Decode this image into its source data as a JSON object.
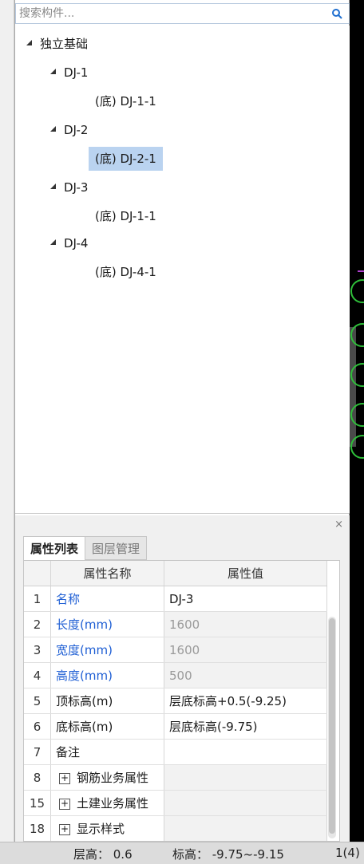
{
  "search": {
    "placeholder": "搜索构件...",
    "value": ""
  },
  "tree": {
    "root": "独立基础",
    "groups": [
      {
        "label": "DJ-1",
        "child": "(底) DJ-1-1"
      },
      {
        "label": "DJ-2",
        "child": "(底) DJ-2-1"
      },
      {
        "label": "DJ-3",
        "child": "(底) DJ-1-1"
      },
      {
        "label": "DJ-4",
        "child": "(底) DJ-4-1"
      }
    ]
  },
  "props": {
    "close": "×",
    "tabs": [
      "属性列表",
      "图层管理"
    ],
    "headers": [
      "属性名称",
      "属性值"
    ],
    "rows": [
      {
        "num": "1",
        "name": "名称",
        "value": "DJ-3"
      },
      {
        "num": "2",
        "name": "长度(mm)",
        "value": "1600"
      },
      {
        "num": "3",
        "name": "宽度(mm)",
        "value": "1600"
      },
      {
        "num": "4",
        "name": "高度(mm)",
        "value": "500"
      },
      {
        "num": "5",
        "name": "顶标高(m)",
        "value": "层底标高+0.5(-9.25)"
      },
      {
        "num": "6",
        "name": "底标高(m)",
        "value": "层底标高(-9.75)"
      },
      {
        "num": "7",
        "name": "备注",
        "value": ""
      },
      {
        "num": "8",
        "name": "钢筋业务属性",
        "value": ""
      },
      {
        "num": "15",
        "name": "土建业务属性",
        "value": ""
      },
      {
        "num": "18",
        "name": "显示样式",
        "value": ""
      }
    ],
    "expand": "+"
  },
  "status": {
    "layer_height": "层高： 0.6",
    "elevation": "标高： -9.75~-9.15",
    "page": "1(4)"
  },
  "colors": {
    "selection": "#bad3f0",
    "link_blue": "#1f5fd4"
  },
  "icons": [
    "search-icon",
    "expand-triangle-icon",
    "plus-expand-icon",
    "close-icon"
  ]
}
